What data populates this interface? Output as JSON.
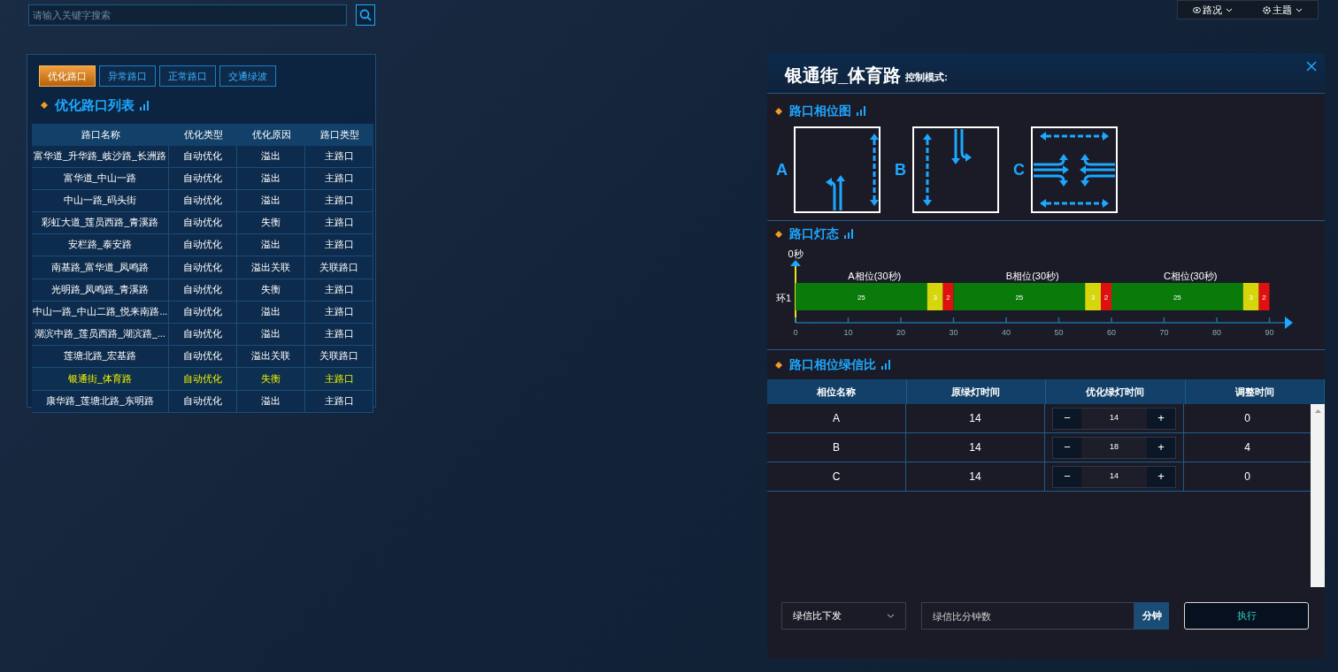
{
  "search": {
    "placeholder": "请输入关键字搜索"
  },
  "top_menu": [
    {
      "label": "路况",
      "kind": "eye"
    },
    {
      "label": "主题",
      "kind": "gear"
    }
  ],
  "left_panel": {
    "tabs": [
      {
        "label": "优化路口",
        "selected": true
      },
      {
        "label": "异常路口",
        "selected": false
      },
      {
        "label": "正常路口",
        "selected": false
      },
      {
        "label": "交通绿波",
        "selected": false
      }
    ],
    "title": "优化路口列表",
    "table": {
      "columns": [
        "路口名称",
        "优化类型",
        "优化原因",
        "路口类型"
      ],
      "rows": [
        {
          "cells": [
            "富华道_升华路_岐沙路_长洲路",
            "自动优化",
            "溢出",
            "主路口"
          ],
          "selected": false
        },
        {
          "cells": [
            "富华道_中山一路",
            "自动优化",
            "溢出",
            "主路口"
          ],
          "selected": false
        },
        {
          "cells": [
            "中山一路_码头街",
            "自动优化",
            "溢出",
            "主路口"
          ],
          "selected": false
        },
        {
          "cells": [
            "彩虹大道_莲员西路_青溪路",
            "自动优化",
            "失衡",
            "主路口"
          ],
          "selected": false
        },
        {
          "cells": [
            "安栏路_泰安路",
            "自动优化",
            "溢出",
            "主路口"
          ],
          "selected": false
        },
        {
          "cells": [
            "南基路_富华道_凤鸣路",
            "自动优化",
            "溢出关联",
            "关联路口"
          ],
          "selected": false
        },
        {
          "cells": [
            "光明路_凤鸣路_青溪路",
            "自动优化",
            "失衡",
            "主路口"
          ],
          "selected": false
        },
        {
          "cells": [
            "中山一路_中山二路_悦来南路...",
            "自动优化",
            "溢出",
            "主路口"
          ],
          "selected": false
        },
        {
          "cells": [
            "湖滨中路_莲员西路_湖滨路_...",
            "自动优化",
            "溢出",
            "主路口"
          ],
          "selected": false
        },
        {
          "cells": [
            "莲塘北路_宏基路",
            "自动优化",
            "溢出关联",
            "关联路口"
          ],
          "selected": false
        },
        {
          "cells": [
            "银通街_体育路",
            "自动优化",
            "失衡",
            "主路口"
          ],
          "selected": true
        },
        {
          "cells": [
            "康华路_莲塘北路_东明路",
            "自动优化",
            "溢出",
            "主路口"
          ],
          "selected": false
        }
      ]
    }
  },
  "detail": {
    "title": "银通街_体育路",
    "mode_label": "控制模式:",
    "phase_section": {
      "title": "路口相位图",
      "phases": [
        {
          "label": "A",
          "kind": "a"
        },
        {
          "label": "B",
          "kind": "b"
        },
        {
          "label": "C",
          "kind": "c"
        }
      ]
    },
    "light_section": {
      "title": "路口灯态",
      "start_label": "0秒",
      "chart_data": {
        "type": "bar",
        "orientation": "horizontal",
        "stacked": true,
        "categories": [
          "环1"
        ],
        "series": [
          {
            "color": "#0a7a0a",
            "values": [
              25
            ]
          },
          {
            "color": "#d6d60c",
            "values": [
              3
            ]
          },
          {
            "color": "#e01010",
            "values": [
              2
            ]
          },
          {
            "color": "#0a7a0a",
            "values": [
              25
            ]
          },
          {
            "color": "#d6d60c",
            "values": [
              3
            ]
          },
          {
            "color": "#e01010",
            "values": [
              2
            ]
          },
          {
            "color": "#0a7a0a",
            "values": [
              25
            ]
          },
          {
            "color": "#d6d60c",
            "values": [
              3
            ]
          },
          {
            "color": "#e01010",
            "values": [
              2
            ]
          }
        ],
        "data_labels": true,
        "xlim": [
          0,
          90
        ],
        "xticks": [
          0,
          10,
          20,
          30,
          40,
          50,
          60,
          70,
          80,
          90
        ],
        "annotations": [
          "A相位(30秒)",
          "B相位(30秒)",
          "C相位(30秒)"
        ]
      }
    },
    "ratio_section": {
      "title": "路口相位绿信比",
      "columns": [
        "相位名称",
        "原绿灯时间",
        "优化绿灯时间",
        "调整时间"
      ],
      "rows": [
        {
          "name": "A",
          "original": "14",
          "optimized": "14",
          "adjust": "0"
        },
        {
          "name": "B",
          "original": "14",
          "optimized": "18",
          "adjust": "4"
        },
        {
          "name": "C",
          "original": "14",
          "optimized": "14",
          "adjust": "0"
        }
      ],
      "minus": "−",
      "plus": "+"
    },
    "controls": {
      "select": {
        "value": "绿信比下发"
      },
      "minutes": {
        "placeholder": "绿信比分钟数",
        "unit": "分钟"
      },
      "execute": "执行"
    }
  }
}
